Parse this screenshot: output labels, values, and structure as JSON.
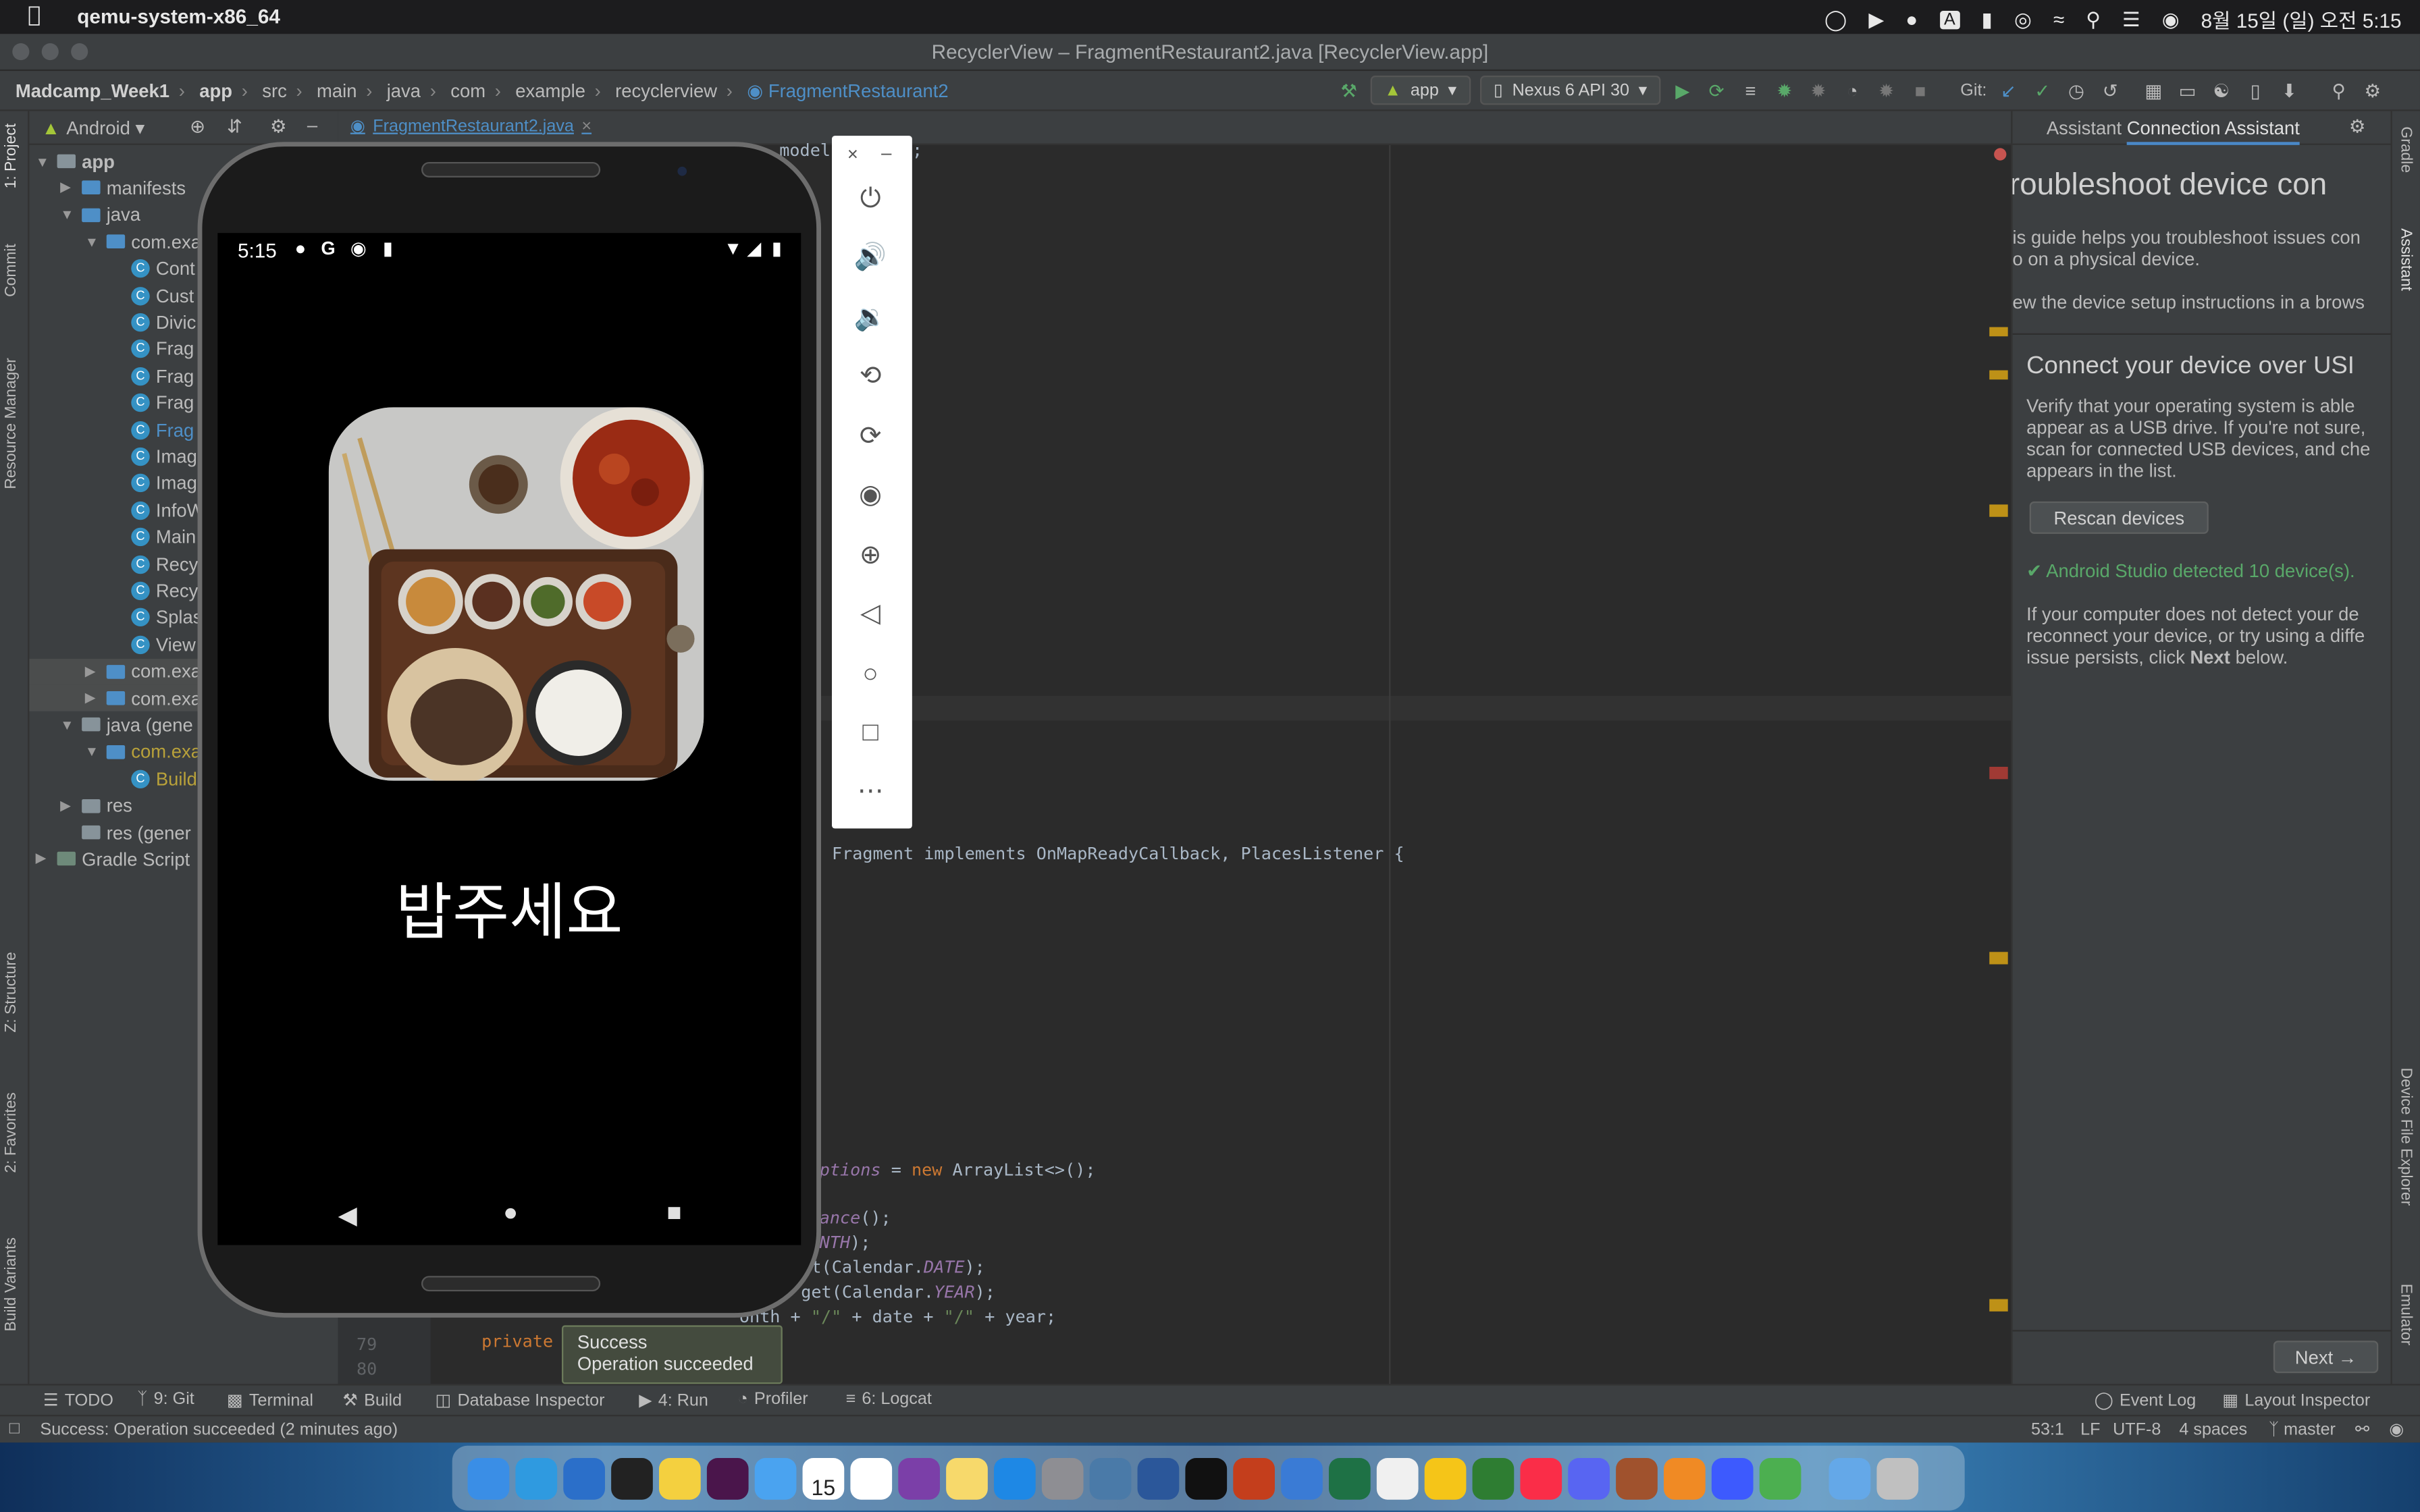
{
  "menubar": {
    "app_name": "qemu-system-x86_64",
    "clock": "8월 15일 (일) 오전 5:15",
    "input_indicator": "A"
  },
  "window": {
    "title": "RecyclerView – FragmentRestaurant2.java [RecyclerView.app]"
  },
  "breadcrumbs": [
    "Madcamp_Week1",
    "app",
    "src",
    "main",
    "java",
    "com",
    "example",
    "recyclerview"
  ],
  "breadcrumb_current": "FragmentRestaurant2",
  "toolbar": {
    "run_config": "app",
    "device": "Nexus 6 API 30",
    "git_label": "Git:"
  },
  "left_strip": {
    "project": "1: Project",
    "commit": "Commit",
    "resource_manager": "Resource Manager",
    "structure": "Z: Structure",
    "favorites": "2: Favorites",
    "build_variants": "Build Variants"
  },
  "project_panel": {
    "view_mode": "Android",
    "tree": [
      {
        "label": "app",
        "depth": 0,
        "kind": "folder",
        "open": true
      },
      {
        "label": "manifests",
        "depth": 1,
        "kind": "folder",
        "open": false
      },
      {
        "label": "java",
        "depth": 1,
        "kind": "folder",
        "open": true
      },
      {
        "label": "com.exa",
        "depth": 2,
        "kind": "package",
        "open": true
      },
      {
        "label": "Cont",
        "depth": 3,
        "kind": "class"
      },
      {
        "label": "Cust",
        "depth": 3,
        "kind": "class"
      },
      {
        "label": "Divic",
        "depth": 3,
        "kind": "class"
      },
      {
        "label": "Frag",
        "depth": 3,
        "kind": "class"
      },
      {
        "label": "Frag",
        "depth": 3,
        "kind": "class"
      },
      {
        "label": "Frag",
        "depth": 3,
        "kind": "class"
      },
      {
        "label": "Frag",
        "depth": 3,
        "kind": "class",
        "active": true
      },
      {
        "label": "Imag",
        "depth": 3,
        "kind": "class"
      },
      {
        "label": "Imag",
        "depth": 3,
        "kind": "class"
      },
      {
        "label": "InfoW",
        "depth": 3,
        "kind": "class"
      },
      {
        "label": "Main",
        "depth": 3,
        "kind": "class"
      },
      {
        "label": "Recy",
        "depth": 3,
        "kind": "class"
      },
      {
        "label": "Recy",
        "depth": 3,
        "kind": "class"
      },
      {
        "label": "Splas",
        "depth": 3,
        "kind": "class"
      },
      {
        "label": "View",
        "depth": 3,
        "kind": "class"
      },
      {
        "label": "com.exa",
        "depth": 2,
        "kind": "package",
        "open": false,
        "selected": true
      },
      {
        "label": "com.exa",
        "depth": 2,
        "kind": "package",
        "open": false,
        "selected": true
      },
      {
        "label": "java (gene",
        "depth": 1,
        "kind": "folder",
        "open": true
      },
      {
        "label": "com.exa",
        "depth": 2,
        "kind": "package-gen",
        "open": true
      },
      {
        "label": "Build",
        "depth": 3,
        "kind": "class-gen"
      },
      {
        "label": "res",
        "depth": 1,
        "kind": "folder",
        "open": false
      },
      {
        "label": "res (gener",
        "depth": 1,
        "kind": "folder"
      },
      {
        "label": "Gradle Script",
        "depth": 0,
        "kind": "gradle",
        "open": false
      }
    ]
  },
  "editor": {
    "tab_label": "FragmentRestaurant2.java",
    "line_top": "model.Options;",
    "line_class": "Fragment implements OnMapReadyCallback, PlacesListener {",
    "line_list": "ptions = new ArrayList<>();",
    "line_cal1": "ance();",
    "line_cal2": "NTH);",
    "line_cal3": "et(Calendar.DATE);",
    "line_cal4": "get(Calendar.YEAR);",
    "line_concat": "onth + \"/\" + date + \"/\" + year;",
    "line_private": "private ",
    "line_no_79": "79",
    "line_no_80": "80"
  },
  "phone": {
    "time": "5:15",
    "app_title": "밥주세요"
  },
  "toast": {
    "line1": "Success",
    "line2": "Operation succeeded"
  },
  "assistant": {
    "tab_assistant": "Assistant",
    "tab_connection": "Connection Assistant",
    "heading": "roubleshoot device con",
    "intro1": "is guide helps you troubleshoot issues con",
    "intro2": "o on a physical device.",
    "intro3": "ew the device setup instructions in a brows",
    "section_title": "Connect your device over USI",
    "para1": "Verify that your operating system is able",
    "para2": "appear as a USB drive. If you're not sure,",
    "para3": "scan for connected USB devices, and che",
    "para4": "appears in the list.",
    "rescan_button": "Rescan devices",
    "detected": "Android Studio detected 10 device(s).",
    "para5": "If your computer does not detect your de",
    "para6": "reconnect your device, or try using a diffe",
    "para7_pre": "issue persists, click ",
    "para7_bold": "Next",
    "para7_post": " below.",
    "next_button": "Next"
  },
  "right_strip": {
    "gradle": "Gradle",
    "assistant": "Assistant",
    "device_file_explorer": "Device File Explorer",
    "emulator": "Emulator"
  },
  "bottom_tools": {
    "todo": "TODO",
    "git": "9: Git",
    "terminal": "Terminal",
    "build": "Build",
    "db_inspector": "Database Inspector",
    "run": "4: Run",
    "profiler": "Profiler",
    "logcat": "6: Logcat",
    "event_log": "Event Log",
    "layout_inspector": "Layout Inspector"
  },
  "status": {
    "message": "Success: Operation succeeded (2 minutes ago)",
    "position": "53:1",
    "line_sep": "LF",
    "encoding": "UTF-8",
    "indent": "4 spaces",
    "branch": "master"
  },
  "dock": {
    "calendar_day": "15",
    "icons": [
      "finder",
      "safari",
      "vscode",
      "terminal",
      "kakaotalk",
      "slack",
      "mail",
      "calendar",
      "notion",
      "onenote",
      "notes",
      "appstore",
      "settings",
      "preview",
      "word",
      "activity-monitor",
      "powerpoint",
      "smartsync",
      "excel",
      "textedit",
      "cyberduck",
      "android-studio",
      "music",
      "discord",
      "shellfish",
      "vlc",
      "app-1",
      "app-2",
      "folder",
      "trash"
    ]
  },
  "colors": {
    "ide_bg": "#2b2b2b",
    "panel_bg": "#3c3f41",
    "accent_blue": "#4e8fc7",
    "keyword": "#cc7832",
    "field": "#9876aa",
    "string": "#6a8759"
  }
}
